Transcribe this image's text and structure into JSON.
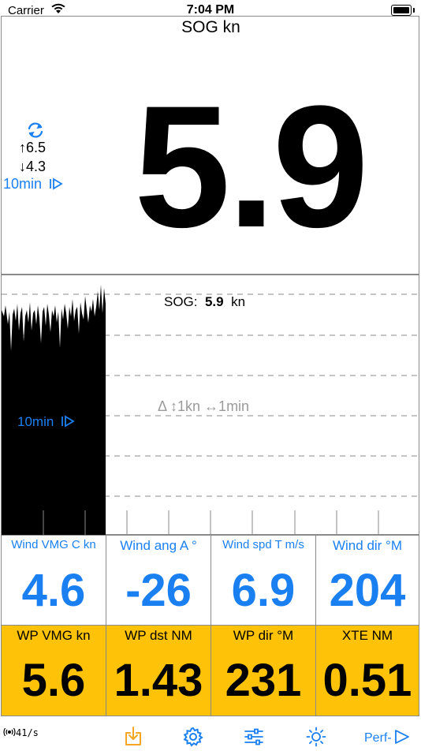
{
  "status_bar": {
    "carrier": "Carrier",
    "time": "7:04 PM"
  },
  "main": {
    "title": "SOG kn",
    "value": "5.9",
    "max": "↑6.5",
    "min": "↓4.3",
    "range": "10min"
  },
  "chart": {
    "label_name": "SOG:",
    "label_value": "5.9",
    "label_unit": "kn",
    "scale": "Δ ↕1kn ↔1min",
    "range": "10min"
  },
  "tiles_row1": [
    {
      "label": "Wind VMG C kn",
      "value": "4.6"
    },
    {
      "label": "Wind ang A °",
      "value": "-26"
    },
    {
      "label": "Wind spd T m/s",
      "value": "6.9"
    },
    {
      "label": "Wind dir °M",
      "value": "204"
    }
  ],
  "tiles_row2": [
    {
      "label": "WP VMG kn",
      "value": "5.6"
    },
    {
      "label": "WP dst NM",
      "value": "1.43"
    },
    {
      "label": "WP dir °M",
      "value": "231"
    },
    {
      "label": "XTE NM",
      "value": "0.51"
    }
  ],
  "tab_bar": {
    "rate": "41/s",
    "perf_label": "Perf-",
    "icons": [
      "import-icon",
      "gear-icon",
      "sliders-icon",
      "brightness-icon"
    ]
  },
  "colors": {
    "accent": "#1a80f2",
    "tile_yellow": "#fec308",
    "border": "#8a8a8a"
  }
}
